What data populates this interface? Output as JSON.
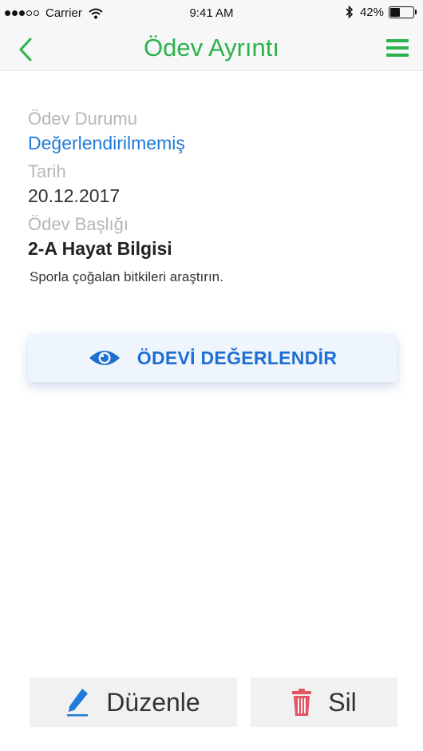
{
  "status_bar": {
    "carrier": "Carrier",
    "time": "9:41 AM",
    "battery_percent": "42%",
    "battery_level": 0.42,
    "signal_bars_filled": 3,
    "signal_bars_total": 5,
    "icons": [
      "wifi-icon",
      "bluetooth-icon",
      "battery-icon"
    ]
  },
  "nav": {
    "title": "Ödev Ayrıntı",
    "back_icon": "chevron-left-icon",
    "menu_icon": "hamburger-menu-icon",
    "accent_color": "#2bb24c"
  },
  "homework": {
    "status_label": "Ödev Durumu",
    "status_value": "Değerlendirilmemiş",
    "date_label": "Tarih",
    "date_value": "20.12.2017",
    "title_label": "Ödev Başlığı",
    "title_value": "2-A Hayat Bilgisi",
    "description": "Sporla çoğalan bitkileri araştırın."
  },
  "actions": {
    "evaluate_label": "ÖDEVİ DEĞERLENDİR",
    "evaluate_icon": "eye-icon",
    "edit_label": "Düzenle",
    "edit_icon": "pencil-icon",
    "delete_label": "Sil",
    "delete_icon": "trash-icon"
  },
  "colors": {
    "status_blue": "#1f7bd8",
    "delete_red": "#e25563"
  }
}
